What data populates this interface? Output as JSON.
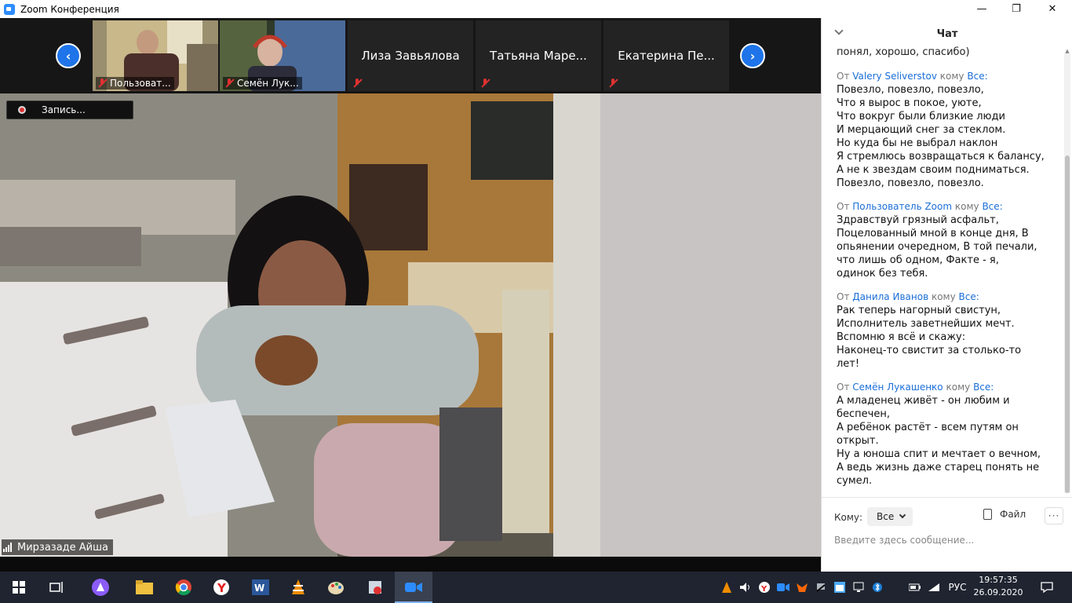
{
  "window": {
    "title": "Zoom Конференция",
    "minimize_glyph": "—",
    "maximize_glyph": "❐",
    "close_glyph": "✕"
  },
  "gallery": {
    "prev_glyph": "‹",
    "next_glyph": "›",
    "tiles": [
      {
        "name": "Пользоват...",
        "type": "video"
      },
      {
        "name": "Семён Лук...",
        "type": "video"
      },
      {
        "name": "Лиза Завьялова",
        "type": "name"
      },
      {
        "name": "Татьяна Маре...",
        "type": "name"
      },
      {
        "name": "Екатерина Пе...",
        "type": "name"
      }
    ]
  },
  "recording": {
    "label": "Запись..."
  },
  "speaker": {
    "name": "Мирзазаде Айша"
  },
  "chat": {
    "title": "Чат",
    "cut_top_line": "понял, хорошо, спасибо)",
    "from_word": "От",
    "to_word": "кому",
    "messages": [
      {
        "from": "Valery Seliverstov",
        "to": "Все:",
        "text": "Повезло, повезло, повезло,\nЧто я вырос в покое, уюте,\nЧто вокруг были близкие люди\nИ мерцающий снег за стеклом.\nНо куда бы не выбрал наклон\nЯ стремлюсь возвращаться к балансу,\nА не к звездам своим подниматься.\nПовезло, повезло, повезло."
      },
      {
        "from": "Пользователь Zoom",
        "to": "Все:",
        "text": "Здравствуй грязный асфальт,\nПоцелованный мной в конце дня,  В\nопьянении очередном,  В той печали,\nчто лишь об одном,  Факте - я,\nодинок без тебя."
      },
      {
        "from": "Данила Иванов",
        "to": "Все:",
        "text": "Рак теперь нагорный свистун,\nИсполнитель заветнейших мечт.\nВспомню я всё и скажу:\nНаконец-то свистит за столько-то\nлет!"
      },
      {
        "from": "Семён Лукашенко",
        "to": "Все:",
        "text": "А младенец живёт - он любим и\nбеспечен,\nА ребёнок растёт - всем путям он\nоткрыт.\nНу а юноша спит и мечтает о вечном,\nА ведь жизнь даже старец понять не\nсумел."
      }
    ],
    "footer": {
      "to_label": "Кому:",
      "to_value": "Все",
      "file_label": "Файл",
      "more_label": "···",
      "input_placeholder": "Введите здесь сообщение..."
    }
  },
  "taskbar": {
    "apps": [
      "start-icon",
      "task-view-icon",
      "alice-icon",
      "file-explorer-icon",
      "chrome-icon",
      "yandex-browser-icon",
      "word-icon",
      "vlc-icon",
      "paint-icon",
      "app-icon",
      "zoom-icon"
    ],
    "language": "РУС",
    "time": "19:57:35",
    "date": "26.09.2020"
  },
  "colors": {
    "accent": "#1e74e8",
    "taskbar": "#1f2430",
    "mute_red": "#e03131"
  }
}
